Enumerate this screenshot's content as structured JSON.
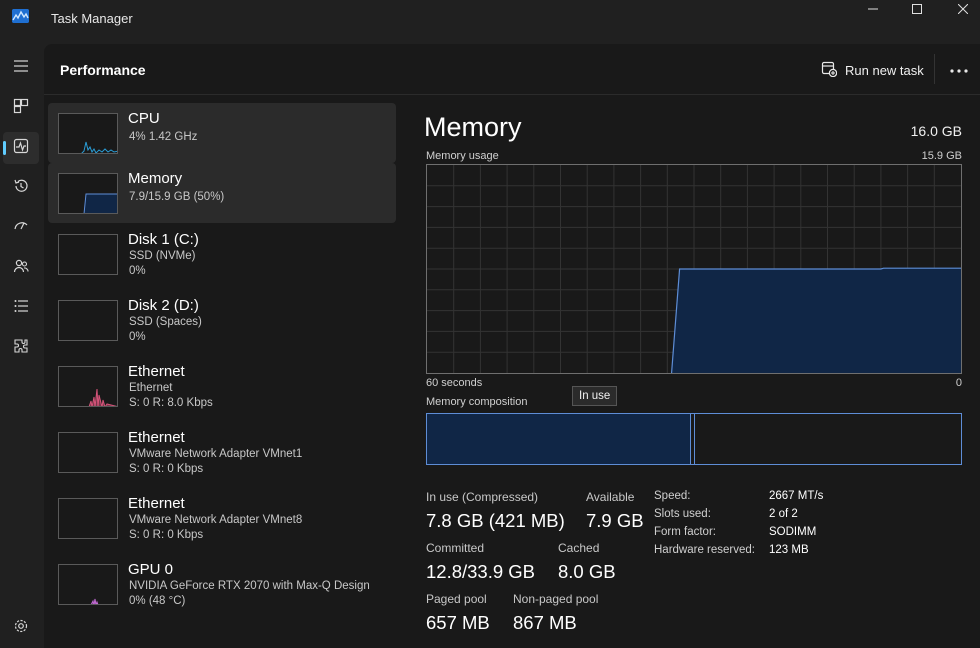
{
  "window": {
    "title": "Task Manager",
    "controls": [
      "minimize-icon",
      "maximize-icon",
      "close-icon"
    ]
  },
  "nav": {
    "items": [
      {
        "name": "hamburger-icon"
      },
      {
        "name": "processes-icon"
      },
      {
        "name": "performance-icon",
        "active": true
      },
      {
        "name": "app-history-icon"
      },
      {
        "name": "startup-apps-icon"
      },
      {
        "name": "users-icon"
      },
      {
        "name": "details-icon"
      },
      {
        "name": "services-icon"
      },
      {
        "name": "settings-icon"
      }
    ]
  },
  "header": {
    "title": "Performance",
    "run_task": "Run new task",
    "more_icon": "more-icon"
  },
  "devices": [
    {
      "name": "CPU",
      "lines": [
        "4%  1.42 GHz"
      ],
      "color": "#2a9dd6",
      "selected": false
    },
    {
      "name": "Memory",
      "lines": [
        "7.9/15.9 GB (50%)"
      ],
      "color": "#5e8dd6",
      "selected": true
    },
    {
      "name": "Disk 1 (C:)",
      "lines": [
        "SSD (NVMe)",
        "0%"
      ],
      "color": "#6bbf42",
      "selected": false
    },
    {
      "name": "Disk 2 (D:)",
      "lines": [
        "SSD (Spaces)",
        "0%"
      ],
      "color": "#6bbf42",
      "selected": false
    },
    {
      "name": "Ethernet",
      "lines": [
        "Ethernet",
        "S: 0  R: 8.0 Kbps"
      ],
      "color": "#d6547a",
      "selected": false
    },
    {
      "name": "Ethernet",
      "lines": [
        "VMware Network Adapter VMnet1",
        "S: 0  R: 0 Kbps"
      ],
      "color": "#d6547a",
      "selected": false
    },
    {
      "name": "Ethernet",
      "lines": [
        "VMware Network Adapter VMnet8",
        "S: 0  R: 0 Kbps"
      ],
      "color": "#d6547a",
      "selected": false
    },
    {
      "name": "GPU 0",
      "lines": [
        "NVIDIA GeForce RTX 2070 with Max-Q Design",
        "0%  (48 °C)"
      ],
      "color": "#c46bd6",
      "selected": false
    }
  ],
  "memory": {
    "title": "Memory",
    "total": "16.0 GB",
    "usage_label": "Memory usage",
    "usage_max": "15.9 GB",
    "axis_left": "60 seconds",
    "axis_right": "0",
    "composition_label": "Memory composition",
    "tooltip": "In use",
    "usage_fraction": 0.5,
    "inuse_fraction": 0.495,
    "stats": {
      "in_use_label": "In use (Compressed)",
      "in_use_value": "7.8 GB (421 MB)",
      "available_label": "Available",
      "available_value": "7.9 GB",
      "committed_label": "Committed",
      "committed_value": "12.8/33.9 GB",
      "cached_label": "Cached",
      "cached_value": "8.0 GB",
      "paged_label": "Paged pool",
      "paged_value": "657 MB",
      "nonpaged_label": "Non-paged pool",
      "nonpaged_value": "867 MB"
    },
    "details": [
      {
        "label": "Speed:",
        "value": "2667 MT/s"
      },
      {
        "label": "Slots used:",
        "value": "2 of 2"
      },
      {
        "label": "Form factor:",
        "value": "SODIMM"
      },
      {
        "label": "Hardware reserved:",
        "value": "123 MB"
      }
    ]
  },
  "colors": {
    "accent": "#60cdff",
    "memory_line": "#5e8dd6",
    "memory_fill": "#102646"
  }
}
